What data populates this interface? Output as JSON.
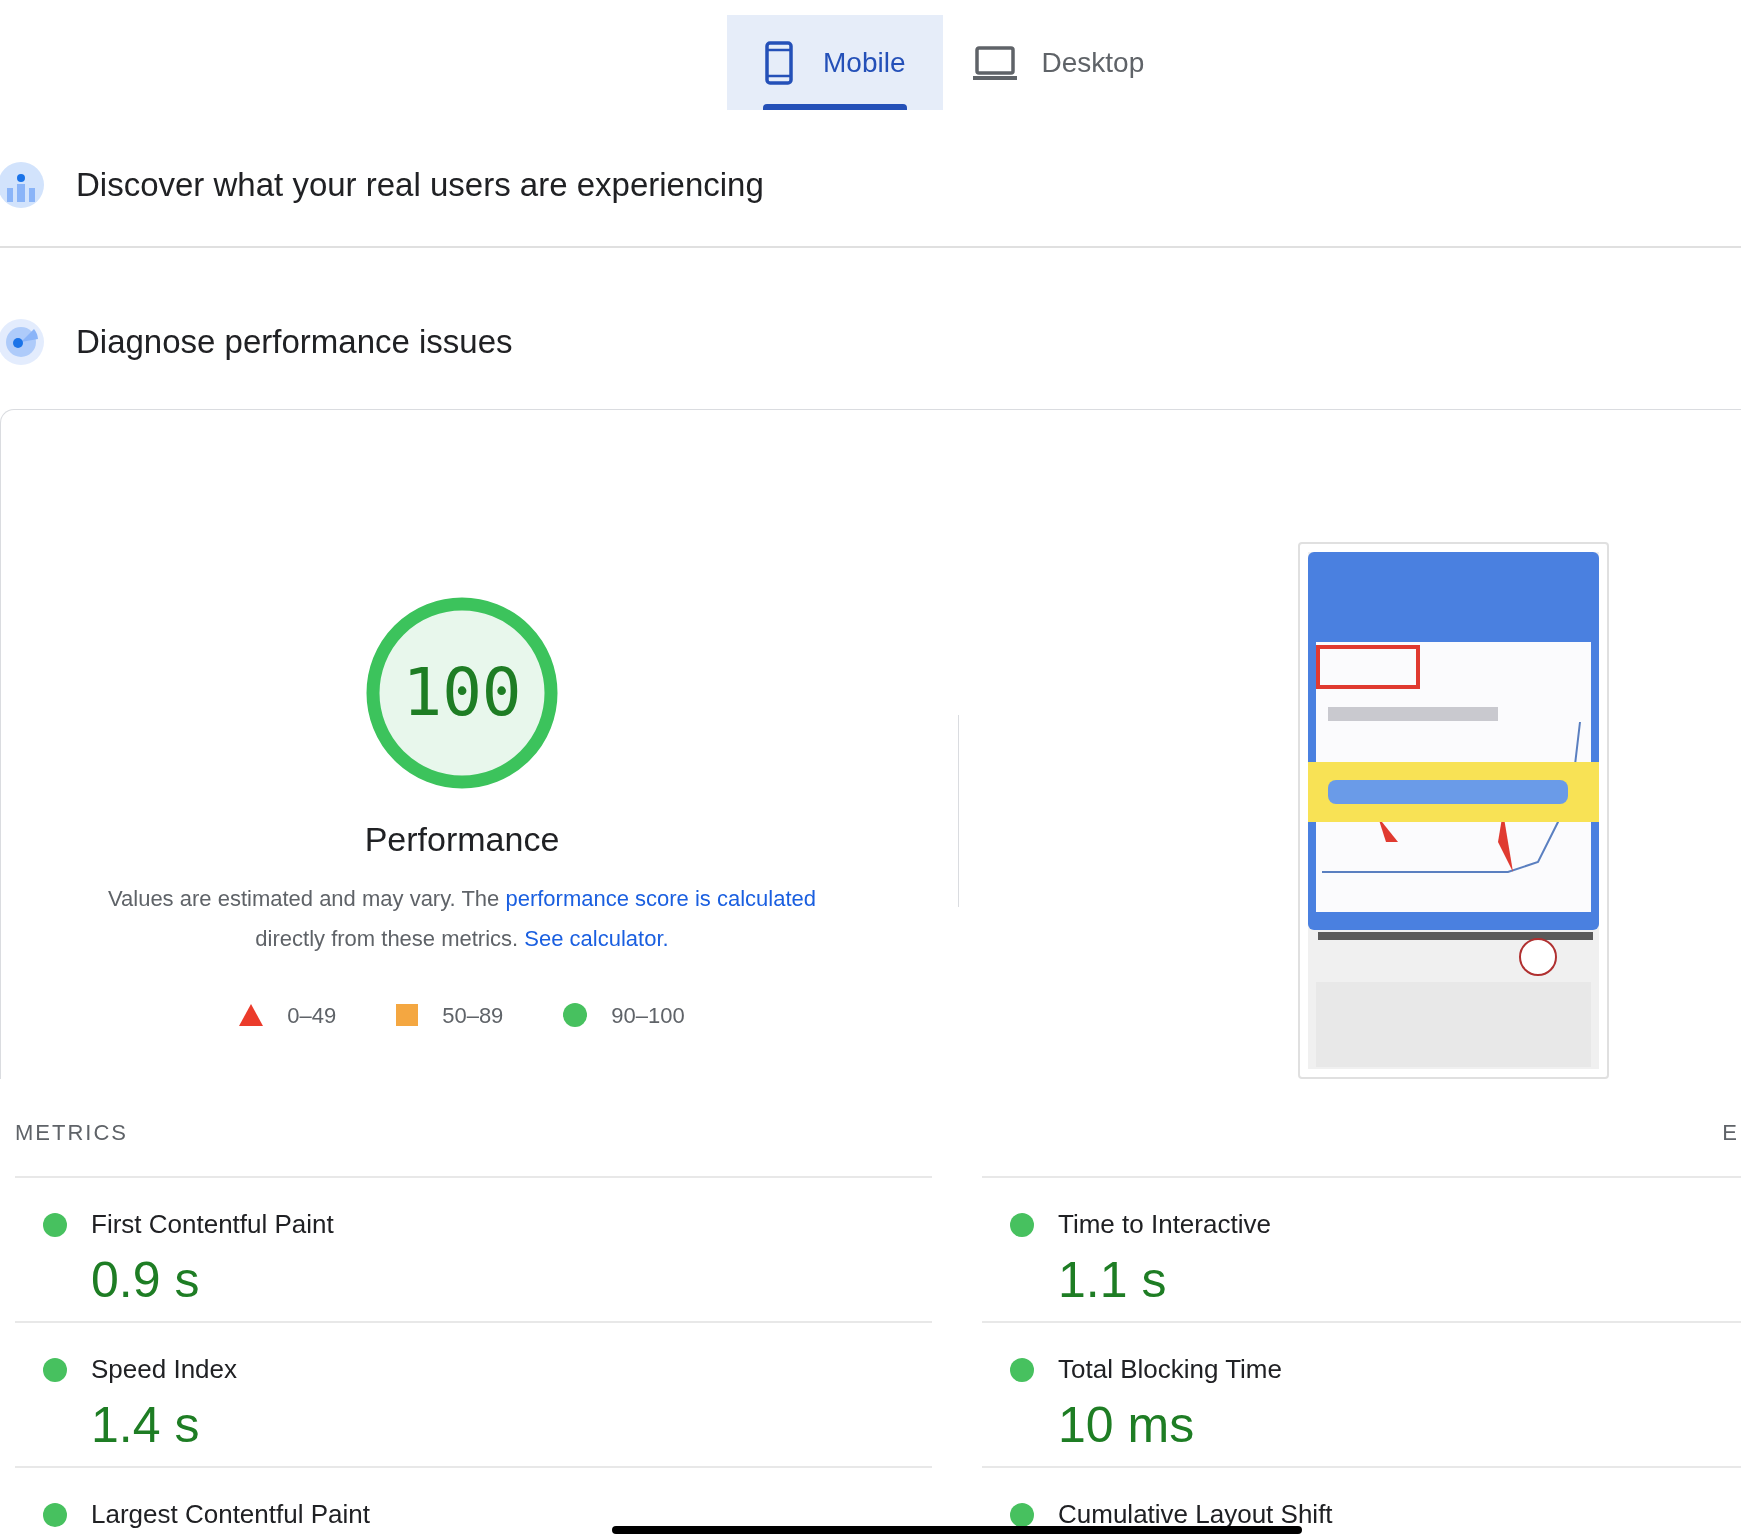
{
  "tabs": [
    {
      "label": "Mobile",
      "kind": "phone",
      "selected": true
    },
    {
      "label": "Desktop",
      "kind": "laptop",
      "selected": false
    }
  ],
  "sections": [
    {
      "kind": "field-data",
      "title": "Discover what your real users are experiencing"
    },
    {
      "kind": "lab-data",
      "title": "Diagnose performance issues"
    }
  ],
  "score": {
    "value": "100",
    "label": "Performance",
    "level": 1
  },
  "description": {
    "parts": [
      {
        "kind": "text",
        "text": "Values are estimated and may vary. The "
      },
      {
        "kind": "link",
        "text": "performance score is calculated"
      },
      {
        "kind": "text",
        "text": " directly from these metrics. "
      },
      {
        "kind": "link",
        "text": "See calculator."
      }
    ]
  },
  "legend": [
    {
      "kind": "triangle",
      "range": "0–49",
      "color": "#eb3b2b"
    },
    {
      "kind": "square",
      "range": "50–89",
      "color": "#f4a741"
    },
    {
      "kind": "circle",
      "range": "90–100",
      "color": "#47c15f"
    }
  ],
  "metrics": {
    "heading": "METRICS",
    "right_heading": "E",
    "items": [
      {
        "label": "First Contentful Paint",
        "value": "0.9 s",
        "color": "#47c15f"
      },
      {
        "label": "Time to Interactive",
        "value": "1.1 s",
        "color": "#47c15f"
      },
      {
        "label": "Speed Index",
        "value": "1.4 s",
        "color": "#47c15f"
      },
      {
        "label": "Total Blocking Time",
        "value": "10 ms",
        "color": "#47c15f"
      },
      {
        "label": "Largest Contentful Paint",
        "color": "#47c15f"
      },
      {
        "label": "Cumulative Layout Shift",
        "color": "#47c15f"
      }
    ]
  }
}
